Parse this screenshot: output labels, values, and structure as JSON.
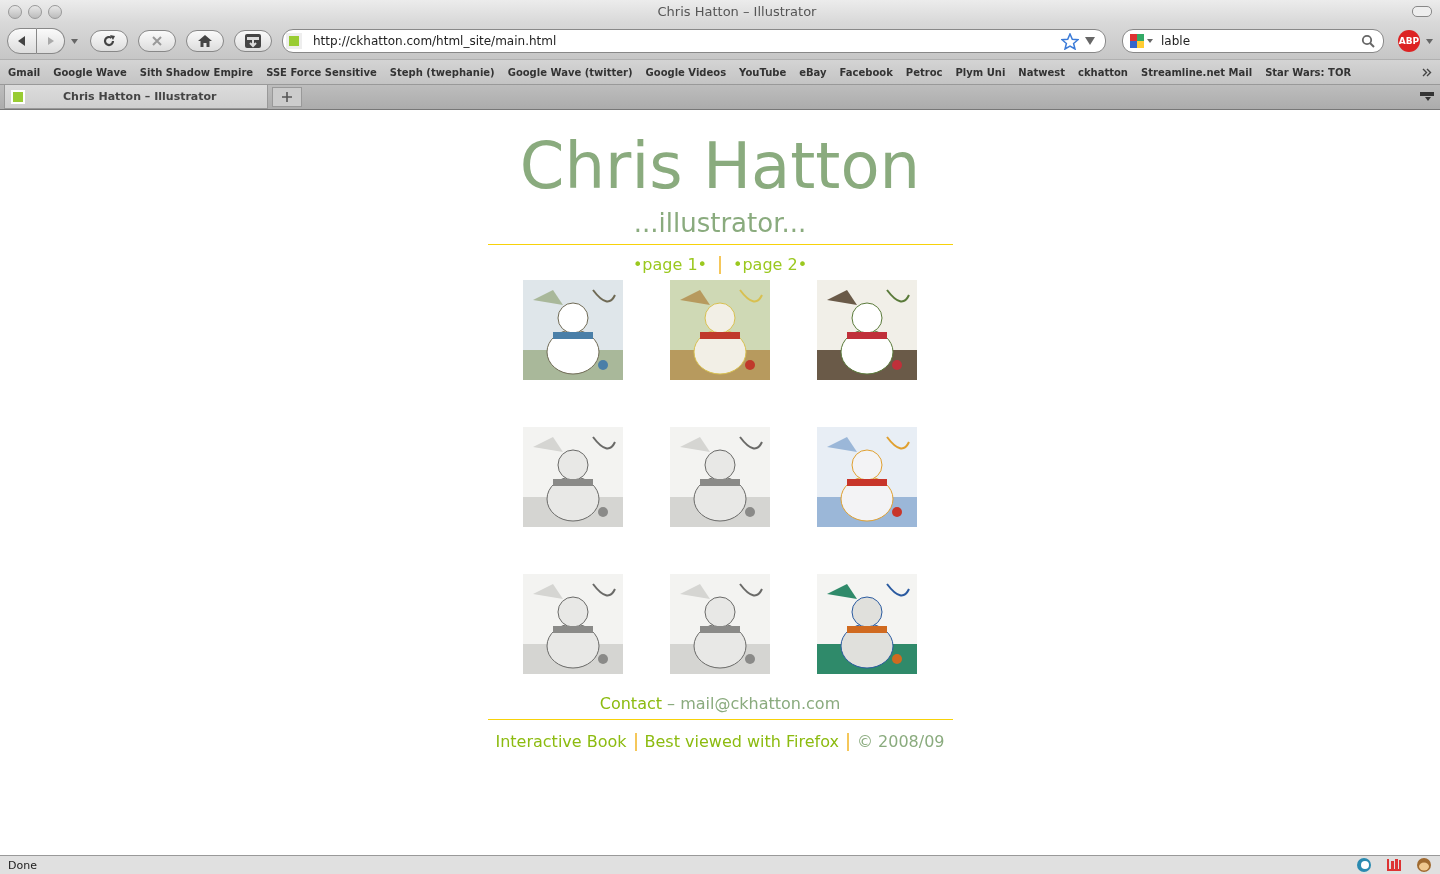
{
  "window": {
    "title": "Chris Hatton – Illustrator"
  },
  "toolbar": {
    "url": "http://ckhatton.com/html_site/main.html",
    "search_value": "lable",
    "addon_badge": "ABP"
  },
  "bookmarks": [
    "Gmail",
    "Google Wave",
    "Sith Shadow Empire",
    "SSE Force Sensitive",
    "Steph (twephanie)",
    "Google Wave (twitter)",
    "Google Videos",
    "YouTube",
    "eBay",
    "Facebook",
    "Petroc",
    "Plym Uni",
    "Natwest",
    "ckhatton",
    "Streamline.net Mail",
    "Star Wars: TOR"
  ],
  "tabs": [
    {
      "label": "Chris Hatton – Illustrator",
      "selected": true
    }
  ],
  "page": {
    "heading": "Chris Hatton",
    "subtitle": "...illustrator...",
    "pages": [
      "•page 1•",
      "•page 2•"
    ],
    "gallery": [
      {
        "kind": "snow"
      },
      {
        "kind": "garden"
      },
      {
        "kind": "house"
      },
      {
        "kind": "sketch"
      },
      {
        "kind": "sketch"
      },
      {
        "kind": "rooster"
      },
      {
        "kind": "sketch"
      },
      {
        "kind": "sketch"
      },
      {
        "kind": "scarves"
      }
    ],
    "contact_label": "Contact",
    "contact_email": "– mail@ckhatton.com",
    "footer_links": [
      "Interactive Book",
      "Best viewed with Firefox"
    ],
    "copyright": "© 2008/09"
  },
  "status_bar": {
    "text": "Done"
  }
}
